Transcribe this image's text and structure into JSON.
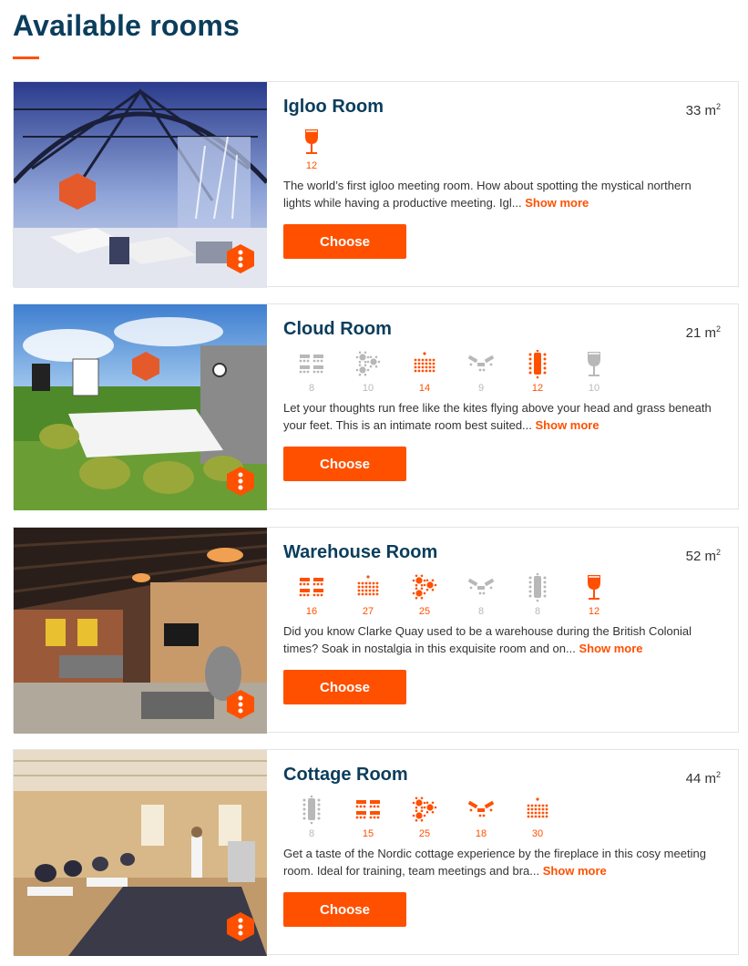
{
  "page": {
    "title": "Available rooms"
  },
  "colors": {
    "accent": "#ff5000",
    "title": "#0b3d5c",
    "inactive_icon": "#b8b8b8"
  },
  "rooms": [
    {
      "name": "Igloo Room",
      "area": "33 m",
      "area_unit_sup": "2",
      "description": "The world’s first igloo meeting room. How about spotting the mystical northern lights while having a productive meeting. Igl...",
      "show_more": "Show more",
      "choose": "Choose",
      "layouts": [
        {
          "icon": "reception-icon",
          "count": "12",
          "active": true
        }
      ]
    },
    {
      "name": "Cloud Room",
      "area": "21 m",
      "area_unit_sup": "2",
      "description": "Let your thoughts run free like the kites flying above your head and grass beneath your feet. This is an intimate room best suited...",
      "show_more": "Show more",
      "choose": "Choose",
      "layouts": [
        {
          "icon": "classroom-icon",
          "count": "8",
          "active": false
        },
        {
          "icon": "cabaret-icon",
          "count": "10",
          "active": false
        },
        {
          "icon": "theatre-icon",
          "count": "14",
          "active": true
        },
        {
          "icon": "ushape-icon",
          "count": "9",
          "active": false
        },
        {
          "icon": "boardroom-icon",
          "count": "12",
          "active": true
        },
        {
          "icon": "reception-icon",
          "count": "10",
          "active": false
        }
      ]
    },
    {
      "name": "Warehouse Room",
      "area": "52 m",
      "area_unit_sup": "2",
      "description": "Did you know Clarke Quay used to be a warehouse during the British Colonial times? Soak in nostalgia in this exquisite room and on...",
      "show_more": "Show more",
      "choose": "Choose",
      "layouts": [
        {
          "icon": "classroom-icon",
          "count": "16",
          "active": true
        },
        {
          "icon": "theatre-icon",
          "count": "27",
          "active": true
        },
        {
          "icon": "cabaret-icon",
          "count": "25",
          "active": true
        },
        {
          "icon": "ushape-icon",
          "count": "8",
          "active": false
        },
        {
          "icon": "boardroom-icon",
          "count": "8",
          "active": false
        },
        {
          "icon": "reception-icon",
          "count": "12",
          "active": true
        }
      ]
    },
    {
      "name": "Cottage Room",
      "area": "44 m",
      "area_unit_sup": "2",
      "description": "Get a taste of the Nordic cottage experience by the fireplace in this cosy meeting room. Ideal for training, team meetings and bra...",
      "show_more": "Show more",
      "choose": "Choose",
      "layouts": [
        {
          "icon": "boardroom-icon",
          "count": "8",
          "active": false
        },
        {
          "icon": "classroom-icon",
          "count": "15",
          "active": true
        },
        {
          "icon": "cabaret-icon",
          "count": "25",
          "active": true
        },
        {
          "icon": "ushape-icon",
          "count": "18",
          "active": true
        },
        {
          "icon": "theatre-icon",
          "count": "30",
          "active": true
        }
      ]
    }
  ]
}
